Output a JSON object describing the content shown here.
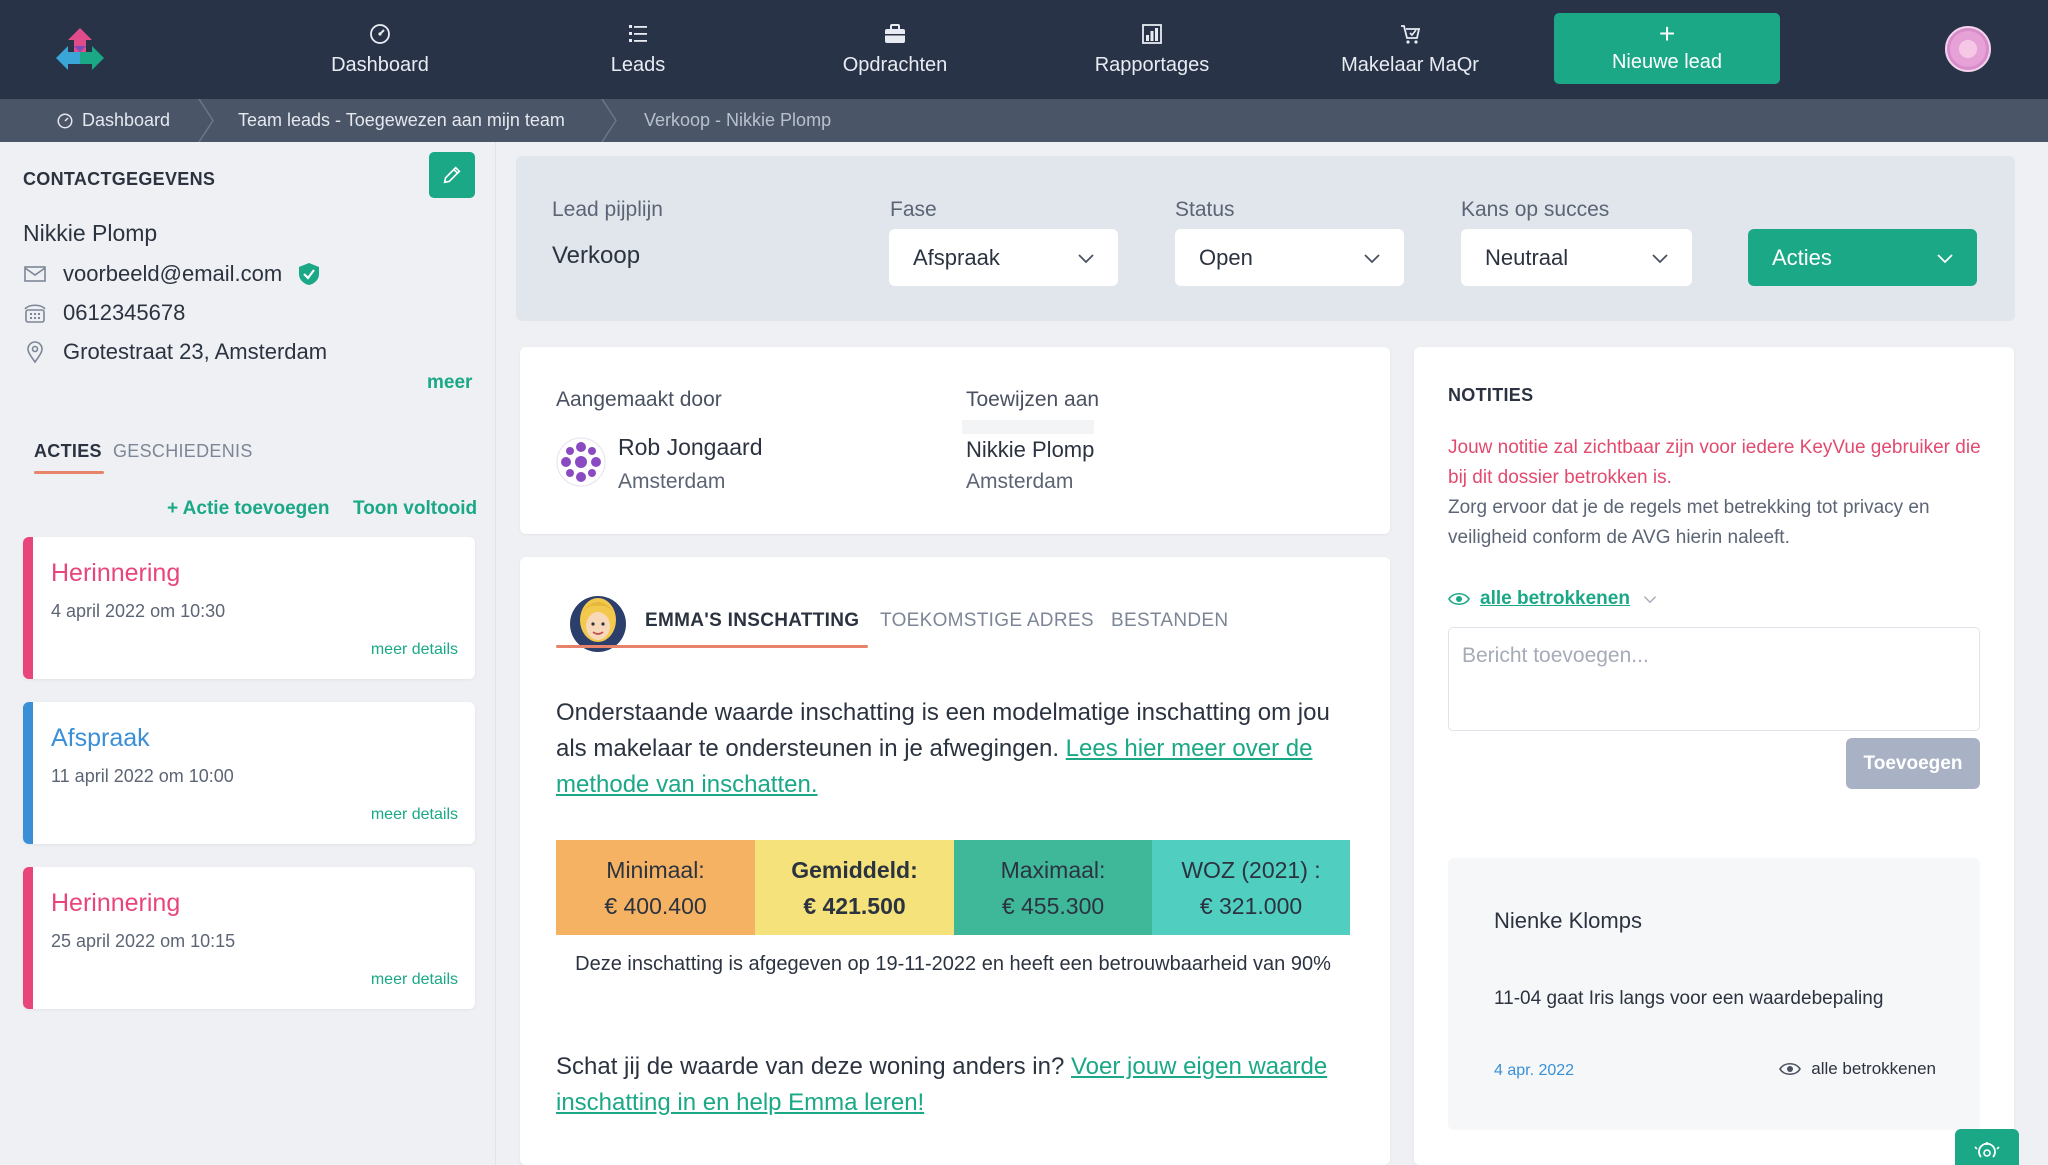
{
  "nav": {
    "items": [
      {
        "label": "Dashboard",
        "icon": "dashboard-icon"
      },
      {
        "label": "Leads",
        "icon": "list-icon"
      },
      {
        "label": "Opdrachten",
        "icon": "briefcase-icon"
      },
      {
        "label": "Rapportages",
        "icon": "chart-icon"
      },
      {
        "label": "Makelaar MaQr",
        "icon": "cart-icon"
      }
    ],
    "new_lead_label": "Nieuwe lead"
  },
  "breadcrumb": {
    "items": [
      "Dashboard",
      "Team leads - Toegewezen aan mijn team",
      "Verkoop - Nikkie Plomp"
    ]
  },
  "contact": {
    "title": "CONTACTGEGEVENS",
    "name": "Nikkie Plomp",
    "email": "voorbeeld@email.com",
    "phone": "0612345678",
    "address": "Grotestraat 23, Amsterdam",
    "more_label": "meer"
  },
  "side_tabs": {
    "active": "ACTIES",
    "inactive": "GESCHIEDENIS"
  },
  "side_actions": {
    "add": "+ Actie toevoegen",
    "show_done": "Toon voltooid"
  },
  "actions": [
    {
      "title": "Herinnering",
      "date": "4 april 2022 om 10:30",
      "more": "meer details",
      "color": "#e8457a"
    },
    {
      "title": "Afspraak",
      "date": "11 april 2022 om 10:00",
      "more": "meer details",
      "color": "#3a8fd6"
    },
    {
      "title": "Herinnering",
      "date": "25 april 2022 om 10:15",
      "more": "meer details",
      "color": "#e8457a"
    }
  ],
  "pipeline": {
    "lead_label": "Lead pijplijn",
    "lead_value": "Verkoop",
    "fase_label": "Fase",
    "fase_value": "Afspraak",
    "status_label": "Status",
    "status_value": "Open",
    "kans_label": "Kans op succes",
    "kans_value": "Neutraal",
    "acties_label": "Acties"
  },
  "assignment": {
    "created_label": "Aangemaakt door",
    "created_name": "Rob Jongaard",
    "created_city": "Amsterdam",
    "assign_label": "Toewijzen aan",
    "assign_name": "Nikkie Plomp",
    "assign_city": "Amsterdam"
  },
  "estimate": {
    "tabs": [
      "EMMA'S INSCHATTING",
      "TOEKOMSTIGE ADRES",
      "BESTANDEN"
    ],
    "intro_text": "Onderstaande waarde inschatting is een modelmatige inschatting om jou als makelaar te ondersteunen in je afwegingen. ",
    "intro_link": "Lees hier meer over de methode van inschatten.",
    "stats": [
      {
        "label": "Minimaal:",
        "value": "€ 400.400",
        "color": "#f5b262"
      },
      {
        "label": "Gemiddeld:",
        "value": "€ 421.500",
        "color": "#f5e27a"
      },
      {
        "label": "Maximaal:",
        "value": "€ 455.300",
        "color": "#3fb89a"
      },
      {
        "label": "WOZ (2021) :",
        "value": "€ 321.000",
        "color": "#50cfc1"
      }
    ],
    "note": "Deze inschatting is afgegeven op 19-11-2022 en heeft een betrouwbaarheid van 90%",
    "cta_text": "Schat jij de waarde van deze woning anders in? ",
    "cta_link": "Voer jouw eigen waarde inschatting in en help Emma leren!"
  },
  "notes": {
    "title": "NOTITIES",
    "warning": "Jouw notitie zal zichtbaar zijn voor iedere KeyVue gebruiker die bij dit dossier betrokken is.",
    "info": "Zorg ervoor dat je de regels met betrekking tot privacy en veiligheid conform de AVG hierin naleeft.",
    "visibility": "alle betrokkenen",
    "placeholder": "Bericht toevoegen...",
    "add_label": "Toevoegen",
    "item": {
      "author": "Nienke Klomps",
      "text": "11-04 gaat Iris langs voor een waardebepaling",
      "date": "4 apr. 2022",
      "visibility": "alle betrokkenen"
    }
  }
}
